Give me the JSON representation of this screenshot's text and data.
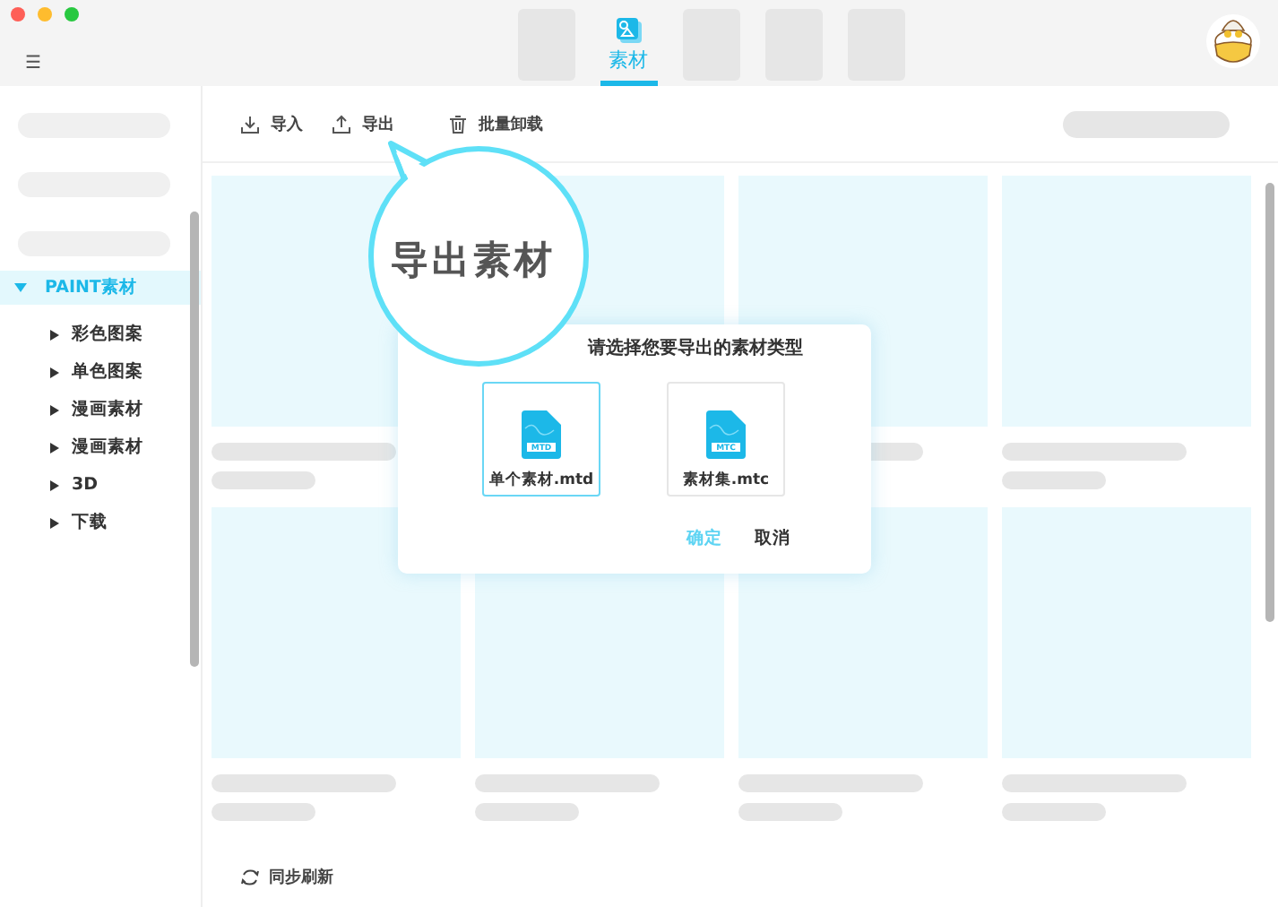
{
  "tabs": [
    {
      "kind": "placeholder",
      "selected": false
    },
    {
      "kind": "tab",
      "label": "素材",
      "selected": true
    },
    {
      "kind": "placeholder",
      "selected": false
    },
    {
      "kind": "placeholder",
      "selected": false
    },
    {
      "kind": "placeholder",
      "selected": false
    }
  ],
  "menu_glyph": "☰",
  "sidebar": {
    "items": [
      {
        "label": "PAINT素材",
        "expanded": true,
        "selected": true,
        "children": [
          {
            "label": "彩色图案",
            "expanded": false,
            "selected": false
          },
          {
            "label": "单色图案",
            "expanded": false,
            "selected": false
          },
          {
            "label": "漫画素材",
            "expanded": false,
            "selected": false
          },
          {
            "label": "漫画素材",
            "expanded": false,
            "selected": false
          },
          {
            "label": "3D",
            "expanded": false,
            "selected": false
          },
          {
            "label": "下载",
            "expanded": false,
            "selected": false
          }
        ]
      }
    ]
  },
  "toolbar": [
    {
      "label": "导入",
      "kind": "import"
    },
    {
      "label": "导出",
      "kind": "export"
    },
    {
      "label": "批量卸载",
      "kind": "delete"
    }
  ],
  "callout": {
    "text": "导出素材"
  },
  "dialog": {
    "title": "请选择您要导出的素材类型",
    "options": [
      {
        "label": "单个素材.mtd",
        "badge": "MTD",
        "selected": true
      },
      {
        "label": "素材集.mtc",
        "badge": "MTC",
        "selected": false
      }
    ],
    "buttons": [
      {
        "label": "确定",
        "kind": "primary"
      },
      {
        "label": "取消",
        "kind": "default"
      }
    ]
  },
  "footer": {
    "label": "同步刷新"
  }
}
